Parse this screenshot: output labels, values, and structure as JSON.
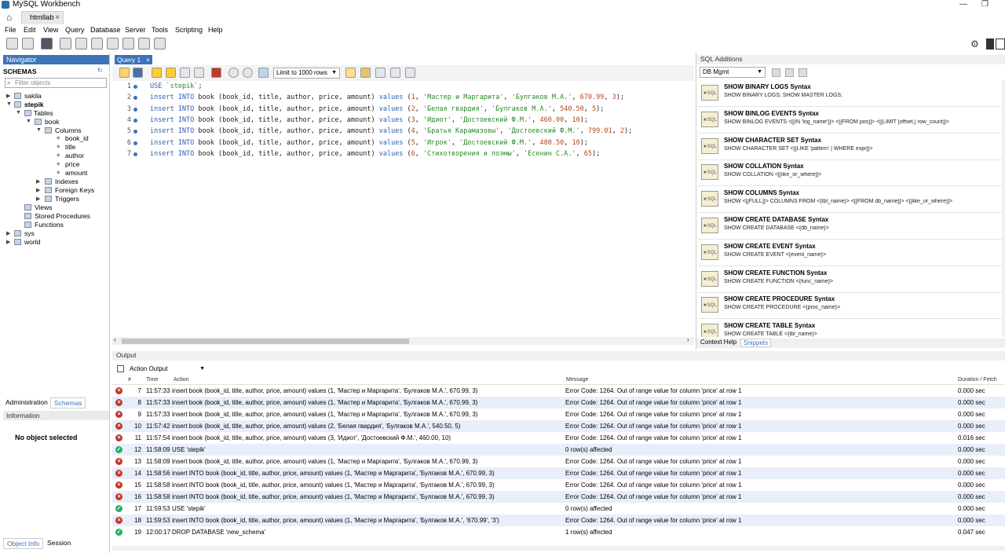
{
  "app": {
    "title": "MySQL Workbench",
    "doc_tab": "htmllab"
  },
  "menu": [
    "File",
    "Edit",
    "View",
    "Query",
    "Database",
    "Server",
    "Tools",
    "Scripting",
    "Help"
  ],
  "navigator": {
    "header": "Navigator",
    "schemas_title": "SCHEMAS",
    "filter_placeholder": "Filter objects",
    "tree": {
      "sakila": "sakila",
      "stepik": "stepik",
      "tables": "Tables",
      "book": "book",
      "columns": "Columns",
      "cols": [
        "book_id",
        "title",
        "author",
        "price",
        "amount"
      ],
      "indexes": "Indexes",
      "foreign_keys": "Foreign Keys",
      "triggers": "Triggers",
      "views": "Views",
      "stored_procedures": "Stored Procedures",
      "functions": "Functions",
      "sys": "sys",
      "world": "world"
    },
    "tabs": {
      "administration": "Administration",
      "schemas": "Schemas"
    },
    "information_header": "Information",
    "no_object": "No object selected",
    "bottom_tabs": {
      "object_info": "Object Info",
      "session": "Session"
    }
  },
  "editor": {
    "tab": "Query 1",
    "limit": "Limit to 1000 rows",
    "lines": [
      {
        "n": "1",
        "parts": [
          [
            "kw",
            "USE "
          ],
          [
            "str",
            "`stepik`"
          ],
          [
            "id",
            ";"
          ]
        ]
      },
      {
        "n": "2",
        "parts": [
          [
            "kw",
            "insert INTO "
          ],
          [
            "id",
            "book (book_id, title, author, price, amount) "
          ],
          [
            "kw",
            "values "
          ],
          [
            "id",
            "("
          ],
          [
            "num",
            "1"
          ],
          [
            "id",
            ", "
          ],
          [
            "str",
            "'Мастер и Маргарита'"
          ],
          [
            "id",
            ", "
          ],
          [
            "str",
            "'Булгаков М.А.'"
          ],
          [
            "id",
            ", "
          ],
          [
            "num",
            "670.99"
          ],
          [
            "id",
            ", "
          ],
          [
            "num",
            "3"
          ],
          [
            "id",
            ");"
          ]
        ]
      },
      {
        "n": "3",
        "parts": [
          [
            "kw",
            "insert INTO "
          ],
          [
            "id",
            "book (book_id, title, author, price, amount) "
          ],
          [
            "kw",
            "values "
          ],
          [
            "id",
            "("
          ],
          [
            "num",
            "2"
          ],
          [
            "id",
            ", "
          ],
          [
            "str",
            "'Белая гвардия'"
          ],
          [
            "id",
            ", "
          ],
          [
            "str",
            "'Булгаков М.А.'"
          ],
          [
            "id",
            ", "
          ],
          [
            "num",
            "540.50"
          ],
          [
            "id",
            ", "
          ],
          [
            "num",
            "5"
          ],
          [
            "id",
            ");"
          ]
        ]
      },
      {
        "n": "4",
        "parts": [
          [
            "kw",
            "insert INTO "
          ],
          [
            "id",
            "book (book_id, title, author, price, amount) "
          ],
          [
            "kw",
            "values "
          ],
          [
            "id",
            "("
          ],
          [
            "num",
            "3"
          ],
          [
            "id",
            ", "
          ],
          [
            "str",
            "'Идиот'"
          ],
          [
            "id",
            ", "
          ],
          [
            "str",
            "'Достоевский Ф.М.'"
          ],
          [
            "id",
            ", "
          ],
          [
            "num",
            "460.00"
          ],
          [
            "id",
            ", "
          ],
          [
            "num",
            "10"
          ],
          [
            "id",
            ");"
          ]
        ]
      },
      {
        "n": "5",
        "parts": [
          [
            "kw",
            "insert INTO "
          ],
          [
            "id",
            "book (book_id, title, author, price, amount) "
          ],
          [
            "kw",
            "values "
          ],
          [
            "id",
            "("
          ],
          [
            "num",
            "4"
          ],
          [
            "id",
            ", "
          ],
          [
            "str",
            "'Братья Карамазовы'"
          ],
          [
            "id",
            ", "
          ],
          [
            "str",
            "'Достоевский Ф.М.'"
          ],
          [
            "id",
            ", "
          ],
          [
            "num",
            "799.01"
          ],
          [
            "id",
            ", "
          ],
          [
            "num",
            "2"
          ],
          [
            "id",
            ");"
          ]
        ]
      },
      {
        "n": "6",
        "parts": [
          [
            "kw",
            "insert INTO "
          ],
          [
            "id",
            "book (book_id, title, author, price, amount) "
          ],
          [
            "kw",
            "values "
          ],
          [
            "id",
            "("
          ],
          [
            "num",
            "5"
          ],
          [
            "id",
            ", "
          ],
          [
            "str",
            "'Игрок'"
          ],
          [
            "id",
            ", "
          ],
          [
            "str",
            "'Достоевский Ф.М.'"
          ],
          [
            "id",
            ", "
          ],
          [
            "num",
            "480.50"
          ],
          [
            "id",
            ", "
          ],
          [
            "num",
            "10"
          ],
          [
            "id",
            ");"
          ]
        ]
      },
      {
        "n": "7",
        "parts": [
          [
            "kw",
            "insert INTO "
          ],
          [
            "id",
            "book (book_id, title, author, price, amount) "
          ],
          [
            "kw",
            "values "
          ],
          [
            "id",
            "("
          ],
          [
            "num",
            "6"
          ],
          [
            "id",
            ", "
          ],
          [
            "str",
            "'Стихотворения и поэмы'"
          ],
          [
            "id",
            ", "
          ],
          [
            "str",
            "'Есенин С.А.'"
          ],
          [
            "id",
            ", "
          ],
          [
            "num",
            "65"
          ],
          [
            "id",
            ");"
          ]
        ]
      }
    ]
  },
  "sql_additions": {
    "header": "SQL Additions",
    "dropdown": "DB Mgmt",
    "snippets": [
      {
        "title": "SHOW BINARY LOGS Syntax",
        "syntax": "SHOW BINARY LOGS; SHOW MASTER LOGS;"
      },
      {
        "title": "SHOW BINLOG EVENTS Syntax",
        "syntax": "SHOW BINLOG EVENTS  <[[IN 'log_name']]> <[[FROM pos]]> <[[LIMIT [offset,] row_count]]>"
      },
      {
        "title": "SHOW CHARACTER SET Syntax",
        "syntax": "SHOW CHARACTER SET <[[LIKE 'pattern' | WHERE expr]]>"
      },
      {
        "title": "SHOW COLLATION Syntax",
        "syntax": "SHOW COLLATION <[[like_or_where]]>"
      },
      {
        "title": "SHOW COLUMNS Syntax",
        "syntax": "SHOW <[[FULL]]> COLUMNS FROM <{tbl_name}> <[[FROM db_name]]> <[[like_or_where]]>"
      },
      {
        "title": "SHOW CREATE DATABASE Syntax",
        "syntax": "SHOW CREATE DATABASE <{db_name}>"
      },
      {
        "title": "SHOW CREATE EVENT Syntax",
        "syntax": "SHOW CREATE EVENT <{event_name}>"
      },
      {
        "title": "SHOW CREATE FUNCTION Syntax",
        "syntax": "SHOW CREATE FUNCTION <{func_name}>"
      },
      {
        "title": "SHOW CREATE PROCEDURE Syntax",
        "syntax": "SHOW CREATE PROCEDURE <{proc_name}>"
      },
      {
        "title": "SHOW CREATE TABLE Syntax",
        "syntax": "SHOW CREATE TABLE <{tbl_name}>"
      }
    ],
    "tabs": {
      "context_help": "Context Help",
      "snippets": "Snippets"
    }
  },
  "output": {
    "header": "Output",
    "selector": "Action Output",
    "columns": {
      "num": "#",
      "time": "Time",
      "action": "Action",
      "message": "Message",
      "duration": "Duration / Fetch"
    },
    "rows": [
      {
        "status": "err",
        "n": "7",
        "time": "11:57:33",
        "action": "insert book (book_id, title, author, price, amount) values (1, 'Мастер и Маргарита', 'Булгаков М.А.', 670.99, 3)",
        "message": "Error Code: 1264. Out of range value for column 'price' at row 1",
        "duration": "0.000 sec"
      },
      {
        "status": "err",
        "n": "8",
        "time": "11:57:33",
        "action": "insert book (book_id, title, author, price, amount) values (1, 'Мастер и Маргарита', 'Булгаков М.А.', 670.99, 3)",
        "message": "Error Code: 1264. Out of range value for column 'price' at row 1",
        "duration": "0.000 sec"
      },
      {
        "status": "err",
        "n": "9",
        "time": "11:57:33",
        "action": "insert book (book_id, title, author, price, amount) values (1, 'Мастер и Маргарита', 'Булгаков М.А.', 670.99, 3)",
        "message": "Error Code: 1264. Out of range value for column 'price' at row 1",
        "duration": "0.000 sec"
      },
      {
        "status": "err",
        "n": "10",
        "time": "11:57:42",
        "action": "insert book (book_id, title, author, price, amount) values (2, 'Белая гвардия', 'Булгаков М.А.', 540.50, 5)",
        "message": "Error Code: 1264. Out of range value for column 'price' at row 1",
        "duration": "0.000 sec"
      },
      {
        "status": "err",
        "n": "11",
        "time": "11:57:54",
        "action": "insert book (book_id, title, author, price, amount) values (3, 'Идиот', 'Достоевский Ф.М.', 460.00, 10)",
        "message": "Error Code: 1264. Out of range value for column 'price' at row 1",
        "duration": "0.016 sec"
      },
      {
        "status": "ok",
        "n": "12",
        "time": "11:58:09",
        "action": "USE 'stepik'",
        "message": "0 row(s) affected",
        "duration": "0.000 sec"
      },
      {
        "status": "err",
        "n": "13",
        "time": "11:58:09",
        "action": "insert book (book_id, title, author, price, amount) values (1, 'Мастер и Маргарита', 'Булгаков М.А.', 670.99, 3)",
        "message": "Error Code: 1264. Out of range value for column 'price' at row 1",
        "duration": "0.000 sec"
      },
      {
        "status": "err",
        "n": "14",
        "time": "11:58:56",
        "action": "insert INTO book (book_id, title, author, price, amount) values (1, 'Мастер и Маргарита', 'Булгаков М.А.', 670.99, 3)",
        "message": "Error Code: 1264. Out of range value for column 'price' at row 1",
        "duration": "0.000 sec"
      },
      {
        "status": "err",
        "n": "15",
        "time": "11:58:58",
        "action": "insert INTO book (book_id, title, author, price, amount) values (1, 'Мастер и Маргарита', 'Булгаков М.А.', 670.99, 3)",
        "message": "Error Code: 1264. Out of range value for column 'price' at row 1",
        "duration": "0.000 sec"
      },
      {
        "status": "err",
        "n": "16",
        "time": "11:58:58",
        "action": "insert INTO book (book_id, title, author, price, amount) values (1, 'Мастер и Маргарита', 'Булгаков М.А.', 670.99, 3)",
        "message": "Error Code: 1264. Out of range value for column 'price' at row 1",
        "duration": "0.000 sec"
      },
      {
        "status": "ok",
        "n": "17",
        "time": "11:59:53",
        "action": "USE 'stepik'",
        "message": "0 row(s) affected",
        "duration": "0.000 sec"
      },
      {
        "status": "err",
        "n": "18",
        "time": "11:59:53",
        "action": "insert INTO book (book_id, title, author, price, amount) values (1, 'Мастер и Маргарита', 'Булгаков М.А.', '670.99', '3')",
        "message": "Error Code: 1264. Out of range value for column 'price' at row 1",
        "duration": "0.000 sec"
      },
      {
        "status": "ok",
        "n": "19",
        "time": "12:00:17",
        "action": "DROP DATABASE 'new_schema'",
        "message": "1 row(s) affected",
        "duration": "0.047 sec"
      }
    ]
  }
}
